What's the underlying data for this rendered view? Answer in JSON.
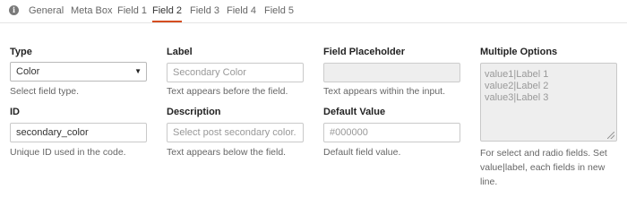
{
  "tabs": {
    "items": [
      "General",
      "Meta Box",
      "Field 1",
      "Field 2",
      "Field 3",
      "Field 4",
      "Field 5"
    ],
    "active": "Field 2"
  },
  "type": {
    "label": "Type",
    "value": "Color",
    "help": "Select field type."
  },
  "id": {
    "label": "ID",
    "value": "secondary_color",
    "help": "Unique ID used in the code."
  },
  "field_label": {
    "label": "Label",
    "placeholder": "Secondary Color",
    "help": "Text appears before the field."
  },
  "description": {
    "label": "Description",
    "placeholder": "Select post secondary color.",
    "help": "Text appears below the field."
  },
  "placeholder_field": {
    "label": "Field Placeholder",
    "value": "",
    "help": "Text appears within the input."
  },
  "default_value": {
    "label": "Default Value",
    "placeholder": "#000000",
    "help": "Default field value."
  },
  "multiple_options": {
    "label": "Multiple Options",
    "placeholder": "value1|Label 1\nvalue2|Label 2\nvalue3|Label 3",
    "help": "For select and radio fields. Set value|label, each fields in new line."
  }
}
